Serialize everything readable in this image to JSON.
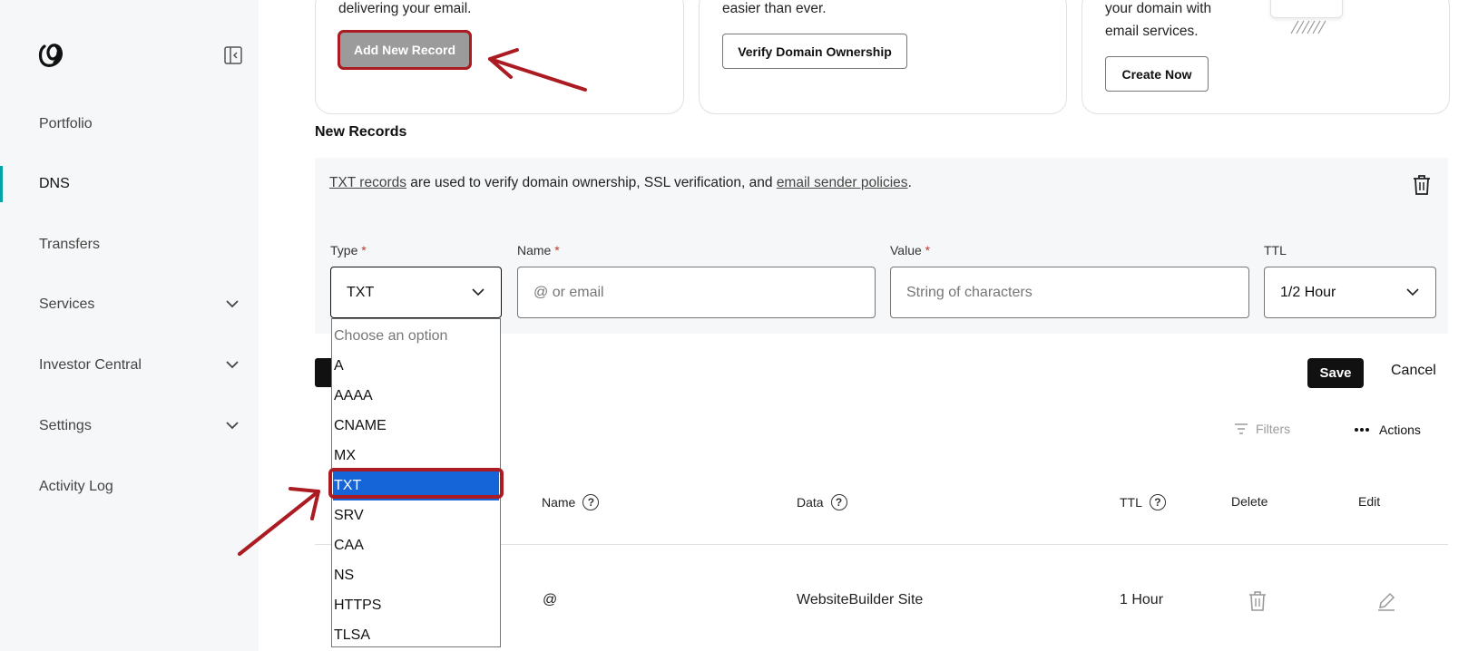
{
  "sidebar": {
    "logo_icon": "godaddy-logo-icon",
    "collapse_icon": "sidebar-collapse-icon",
    "items": [
      {
        "label": "Portfolio",
        "active": false,
        "expandable": false
      },
      {
        "label": "DNS",
        "active": true,
        "expandable": false
      },
      {
        "label": "Transfers",
        "active": false,
        "expandable": false
      },
      {
        "label": "Services",
        "active": false,
        "expandable": true
      },
      {
        "label": "Investor Central",
        "active": false,
        "expandable": true
      },
      {
        "label": "Settings",
        "active": false,
        "expandable": true
      },
      {
        "label": "Activity Log",
        "active": false,
        "expandable": false
      }
    ]
  },
  "cards": [
    {
      "text": "delivering your email.",
      "button": "Add New Record"
    },
    {
      "text": "easier than ever.",
      "button": "Verify Domain Ownership"
    },
    {
      "text_lines": [
        "your domain with",
        "email services."
      ],
      "button": "Create Now"
    }
  ],
  "new_records": {
    "title": "New Records",
    "info_link1": "TXT records",
    "info_mid": " are used to verify domain ownership, SSL verification, and ",
    "info_link2": "email sender policies",
    "info_end": ".",
    "fields": {
      "type": {
        "label": "Type",
        "value": "TXT"
      },
      "name": {
        "label": "Name",
        "placeholder": "@ or email"
      },
      "value": {
        "label": "Value",
        "placeholder": "String of characters"
      },
      "ttl": {
        "label": "TTL",
        "value": "1/2 Hour"
      }
    },
    "required_mark": "*",
    "type_options": [
      "Choose an option",
      "A",
      "AAAA",
      "CNAME",
      "MX",
      "TXT",
      "SRV",
      "CAA",
      "NS",
      "HTTPS",
      "TLSA"
    ],
    "selected_option": "TXT",
    "save_label": "Save",
    "cancel_label": "Cancel"
  },
  "toolbar": {
    "filters_label": "Filters",
    "actions_label": "Actions"
  },
  "table": {
    "columns": [
      "Name",
      "Data",
      "TTL",
      "Delete",
      "Edit"
    ],
    "help_glyph": "?",
    "rows": [
      {
        "name": "@",
        "data": "WebsiteBuilder Site",
        "ttl": "1 Hour"
      }
    ]
  },
  "colors": {
    "annotation": "#ab1c22",
    "selected": "#1665d8",
    "accent": "#00a4a6"
  }
}
